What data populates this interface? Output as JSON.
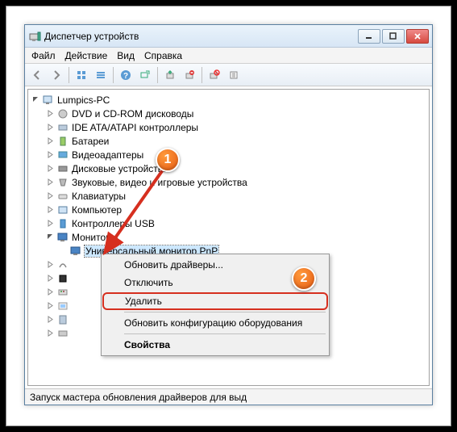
{
  "window": {
    "title": "Диспетчер устройств"
  },
  "menu": {
    "file": "Файл",
    "action": "Действие",
    "view": "Вид",
    "help": "Справка"
  },
  "tree": {
    "root": "Lumpics-PC",
    "items": [
      "DVD и CD-ROM дисководы",
      "IDE ATA/ATAPI контроллеры",
      "Батареи",
      "Видеоадаптеры",
      "Дисковые устройства",
      "Звуковые, видео и игровые устройства",
      "Клавиатуры",
      "Компьютер",
      "Контроллеры USB",
      "Мониторы"
    ],
    "selected_child": "Универсальный монитор PnP",
    "trailing": [
      "",
      "",
      "",
      "",
      "",
      ""
    ]
  },
  "context": {
    "update": "Обновить драйверы...",
    "disable": "Отключить",
    "delete": "Удалить",
    "scan": "Обновить конфигурацию оборудования",
    "props": "Свойства"
  },
  "status": "Запуск мастера обновления драйверов для выд",
  "badges": {
    "b1": "1",
    "b2": "2"
  }
}
